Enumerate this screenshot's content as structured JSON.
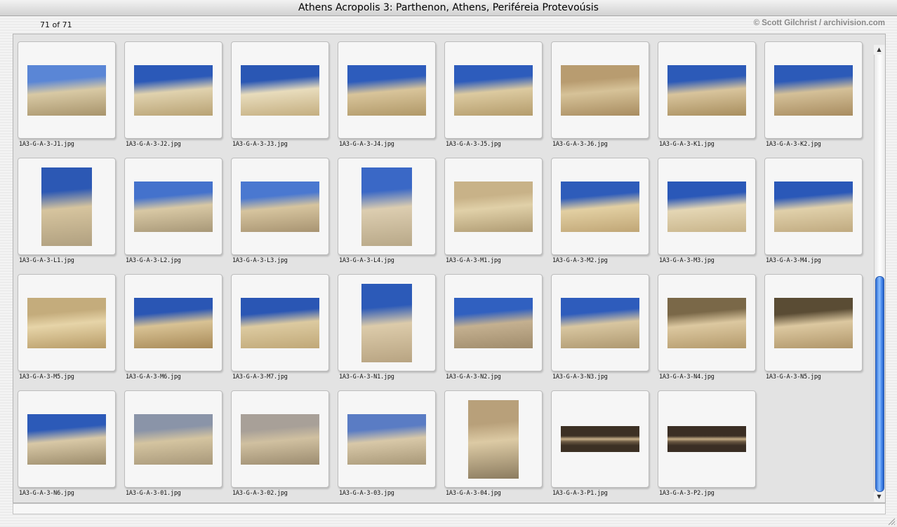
{
  "window": {
    "title": "Athens Acropolis 3: Parthenon, Athens, Periféreia Protevoúsis"
  },
  "info": {
    "count": "71 of 71",
    "credit": "© Scott Gilchrist / archivision.com"
  },
  "thumbnails": [
    {
      "label": "1A3-G-A-3-J1.jpg",
      "orient": "landscape",
      "c": [
        "#5a86d6",
        "#d8c9a4",
        "#a8946c"
      ]
    },
    {
      "label": "1A3-G-A-3-J2.jpg",
      "orient": "landscape",
      "c": [
        "#2b59b8",
        "#e0d2ae",
        "#b8a274"
      ]
    },
    {
      "label": "1A3-G-A-3-J3.jpg",
      "orient": "landscape",
      "c": [
        "#2a57b4",
        "#e8dcbc",
        "#c4ae80"
      ]
    },
    {
      "label": "1A3-G-A-3-J4.jpg",
      "orient": "landscape",
      "c": [
        "#2d5cbc",
        "#d8c49a",
        "#b09868"
      ]
    },
    {
      "label": "1A3-G-A-3-J5.jpg",
      "orient": "landscape",
      "c": [
        "#2d5cbc",
        "#dccaa0",
        "#b49c6c"
      ]
    },
    {
      "label": "1A3-G-A-3-J6.jpg",
      "orient": "landscape",
      "c": [
        "#b89c70",
        "#d6c298",
        "#a88c60"
      ]
    },
    {
      "label": "1A3-G-A-3-K1.jpg",
      "orient": "landscape",
      "c": [
        "#2c5ab8",
        "#d8c49c",
        "#a88e5e"
      ]
    },
    {
      "label": "1A3-G-A-3-K2.jpg",
      "orient": "landscape",
      "c": [
        "#2c5ab8",
        "#d4c098",
        "#a88c60"
      ]
    },
    {
      "label": "1A3-G-A-3-L1.jpg",
      "orient": "portrait",
      "c": [
        "#2c58b4",
        "#d6c49e",
        "#b0a080"
      ]
    },
    {
      "label": "1A3-G-A-3-L2.jpg",
      "orient": "landscape",
      "c": [
        "#4472cc",
        "#d8c8a4",
        "#a89878"
      ]
    },
    {
      "label": "1A3-G-A-3-L3.jpg",
      "orient": "landscape",
      "c": [
        "#4a78d0",
        "#d6c49e",
        "#a89472"
      ]
    },
    {
      "label": "1A3-G-A-3-L4.jpg",
      "orient": "portrait",
      "c": [
        "#3a68c6",
        "#dccdb0",
        "#b8a888"
      ]
    },
    {
      "label": "1A3-G-A-3-M1.jpg",
      "orient": "landscape",
      "c": [
        "#c8b288",
        "#e0d0a8",
        "#b09c74"
      ]
    },
    {
      "label": "1A3-G-A-3-M2.jpg",
      "orient": "landscape",
      "c": [
        "#2e5cba",
        "#e2cfa2",
        "#c0a676"
      ]
    },
    {
      "label": "1A3-G-A-3-M3.jpg",
      "orient": "landscape",
      "c": [
        "#2a58b8",
        "#e4d6b4",
        "#c8b48a"
      ]
    },
    {
      "label": "1A3-G-A-3-M4.jpg",
      "orient": "landscape",
      "c": [
        "#2a58b8",
        "#e0d0aa",
        "#c0aa80"
      ]
    },
    {
      "label": "1A3-G-A-3-M5.jpg",
      "orient": "landscape",
      "c": [
        "#c4ac7c",
        "#e6d4a8",
        "#b89c68"
      ]
    },
    {
      "label": "1A3-G-A-3-M6.jpg",
      "orient": "landscape",
      "c": [
        "#2a56b4",
        "#d8c294",
        "#a88a58"
      ]
    },
    {
      "label": "1A3-G-A-3-M7.jpg",
      "orient": "landscape",
      "c": [
        "#2a56b4",
        "#dccaa0",
        "#c0a878"
      ]
    },
    {
      "label": "1A3-G-A-3-N1.jpg",
      "orient": "portrait",
      "c": [
        "#2c5ab8",
        "#dccbaa",
        "#b8a482"
      ]
    },
    {
      "label": "1A3-G-A-3-N2.jpg",
      "orient": "landscape",
      "c": [
        "#3060c0",
        "#c4b090",
        "#a08c6c"
      ]
    },
    {
      "label": "1A3-G-A-3-N3.jpg",
      "orient": "landscape",
      "c": [
        "#2e5cbc",
        "#d8c6a0",
        "#ae9870"
      ]
    },
    {
      "label": "1A3-G-A-3-N4.jpg",
      "orient": "landscape",
      "c": [
        "#7a6848",
        "#dcc8a0",
        "#b49a6c"
      ]
    },
    {
      "label": "1A3-G-A-3-N5.jpg",
      "orient": "landscape",
      "c": [
        "#5a4c34",
        "#dcc8a0",
        "#b0966a"
      ]
    },
    {
      "label": "1A3-G-A-3-N6.jpg",
      "orient": "landscape",
      "c": [
        "#2c5ab8",
        "#d8c8a6",
        "#9c8c6c"
      ]
    },
    {
      "label": "1A3-G-A-3-01.jpg",
      "orient": "landscape",
      "c": [
        "#8a94a8",
        "#d4c4a0",
        "#a8987a"
      ]
    },
    {
      "label": "1A3-G-A-3-02.jpg",
      "orient": "landscape",
      "c": [
        "#a8a098",
        "#d0c0a0",
        "#9c8c70"
      ]
    },
    {
      "label": "1A3-G-A-3-03.jpg",
      "orient": "landscape",
      "c": [
        "#5a7cc4",
        "#d8c8a8",
        "#a89878"
      ]
    },
    {
      "label": "1A3-G-A-3-04.jpg",
      "orient": "portrait",
      "c": [
        "#b8a07a",
        "#dccaa4",
        "#8c7c60"
      ]
    },
    {
      "label": "1A3-G-A-3-P1.jpg",
      "orient": "strip",
      "c": [
        "#3c3024",
        "#c8b08a",
        "#6c5a44"
      ]
    },
    {
      "label": "1A3-G-A-3-P2.jpg",
      "orient": "strip",
      "c": [
        "#3a2e24",
        "#c4ac86",
        "#6a5842"
      ]
    }
  ]
}
